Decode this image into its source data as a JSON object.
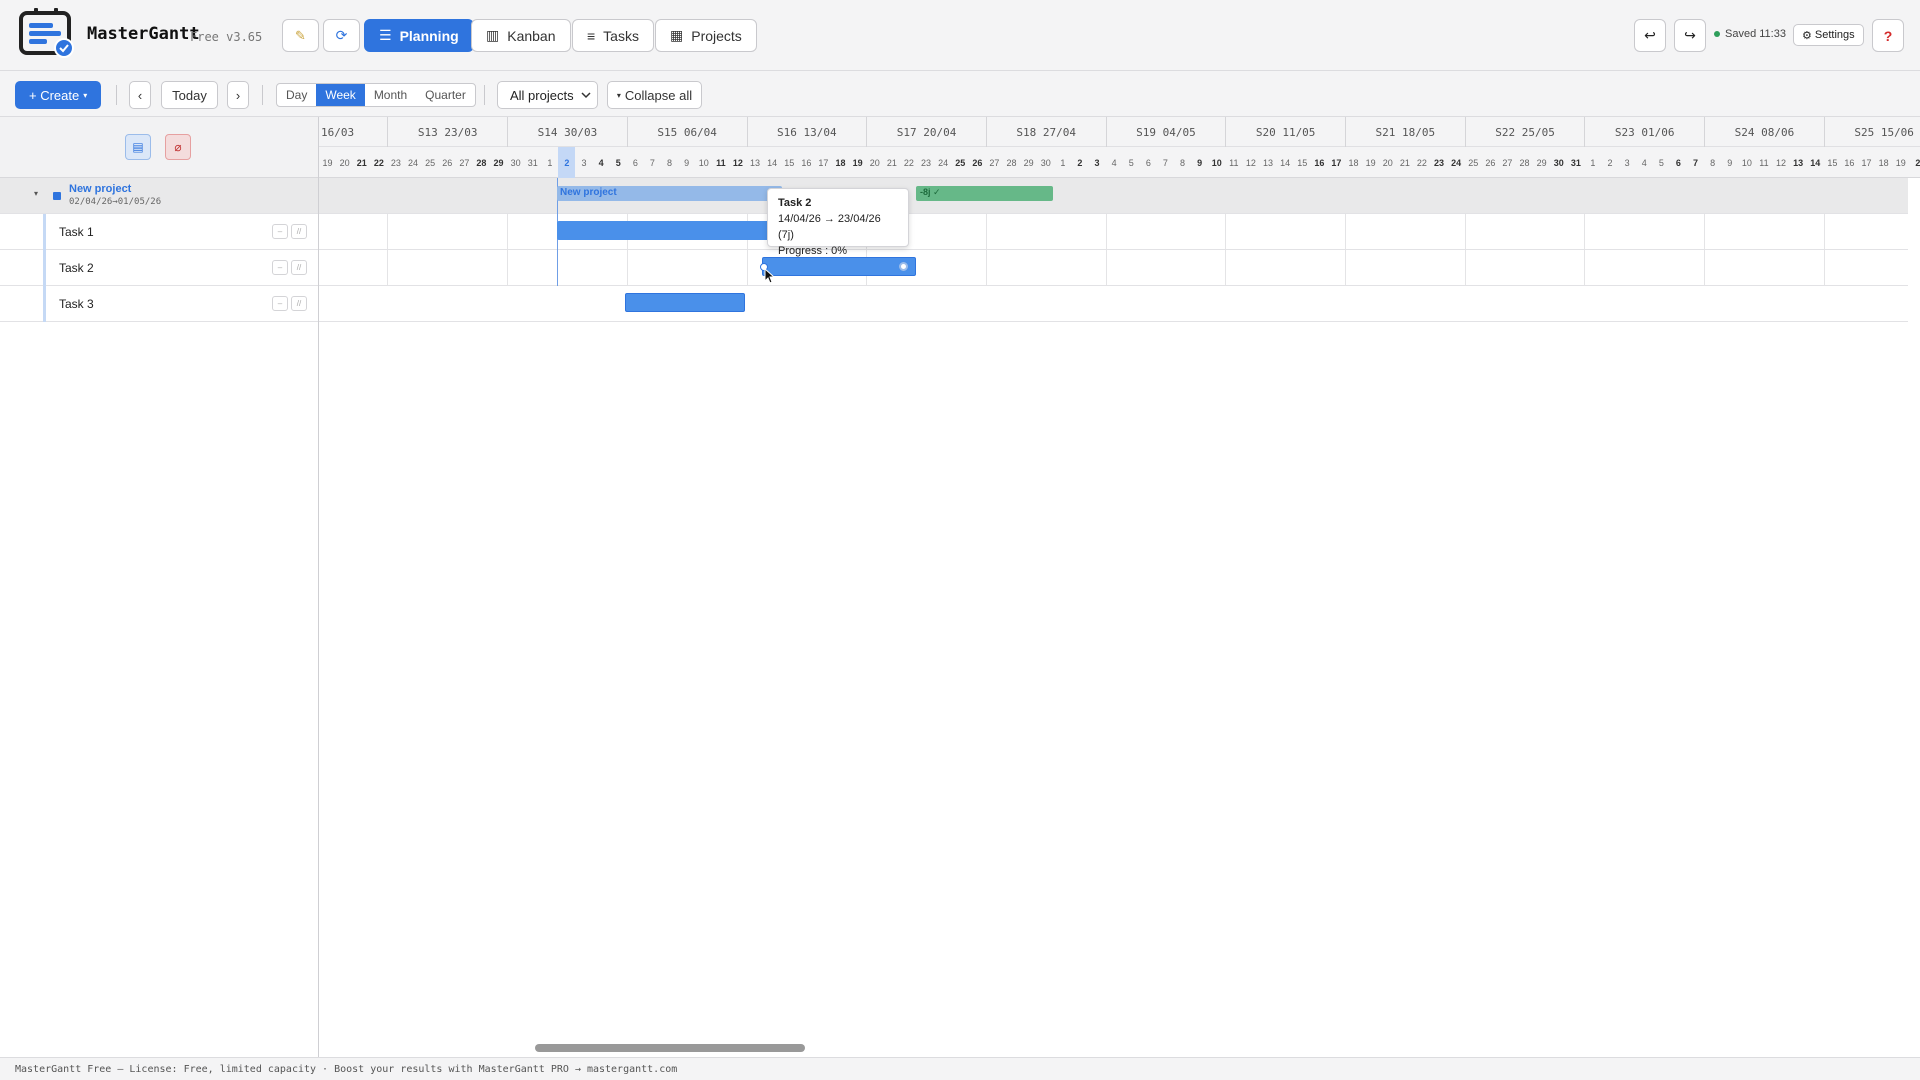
{
  "app": {
    "title": "MasterGantt",
    "version": "Free v3.65",
    "nav": [
      "Planning",
      "Kanban",
      "Tasks",
      "Projects"
    ],
    "active_nav": "Planning",
    "saved_text": "Saved 11:33",
    "settings_label": "Settings",
    "help_label": "?",
    "colors": {
      "accent": "#2f74de",
      "bar": "#4a90ea",
      "project_done": "#66b888",
      "saved_dot": "#2e9e5b"
    }
  },
  "toolbar": {
    "create_label": "+ Create",
    "prev_label": "‹",
    "today_label": "Today",
    "next_label": "›",
    "views": [
      "Day",
      "Week",
      "Month",
      "Quarter"
    ],
    "active_view": "Week",
    "filter_value": "All projects",
    "collapse_label": "Collapse all"
  },
  "timeline": {
    "weeks": [
      "16/03",
      "S13 23/03",
      "S14 30/03",
      "S15 06/04",
      "S16 13/04",
      "S17 20/04",
      "S18 27/04",
      "S19 04/05",
      "S20 11/05",
      "S21 18/05",
      "S22 25/05",
      "S23 01/06",
      "S24 08/06",
      "S25 15/06"
    ],
    "days": [
      "19",
      "20",
      "21",
      "22",
      "23",
      "24",
      "25",
      "26",
      "27",
      "28",
      "29",
      "30",
      "31",
      "1",
      "2",
      "3",
      "4",
      "5",
      "6",
      "7",
      "8",
      "9",
      "10",
      "11",
      "12",
      "13",
      "14",
      "15",
      "16",
      "17",
      "18",
      "19",
      "20",
      "21",
      "22",
      "23",
      "24",
      "25",
      "26",
      "27",
      "28",
      "29",
      "30",
      "1",
      "2",
      "3",
      "4",
      "5",
      "6",
      "7",
      "8",
      "9",
      "10",
      "11",
      "12",
      "13",
      "14",
      "15",
      "16",
      "17",
      "18",
      "19",
      "20",
      "21",
      "22",
      "23",
      "24",
      "25",
      "26",
      "27",
      "28",
      "29",
      "30",
      "31",
      "1",
      "2",
      "3",
      "4",
      "5",
      "6",
      "7",
      "8",
      "9",
      "10",
      "11",
      "12",
      "13",
      "14",
      "15",
      "16",
      "17",
      "18",
      "19",
      "2"
    ],
    "today_label": "2"
  },
  "project": {
    "name": "New project",
    "dates": "02/04/26→01/05/26",
    "bar_label": "New project",
    "done_label": "-8j ✓"
  },
  "tasks": [
    {
      "name": "Task 1"
    },
    {
      "name": "Task 2"
    },
    {
      "name": "Task 3"
    }
  ],
  "tooltip": {
    "title": "Task 2",
    "dates": "14/04/26 → 23/04/26 (7j)",
    "progress": "Progress : 0%"
  },
  "footer": "MasterGantt Free — License: Free, limited capacity · Boost your results with MasterGantt PRO → mastergantt.com"
}
